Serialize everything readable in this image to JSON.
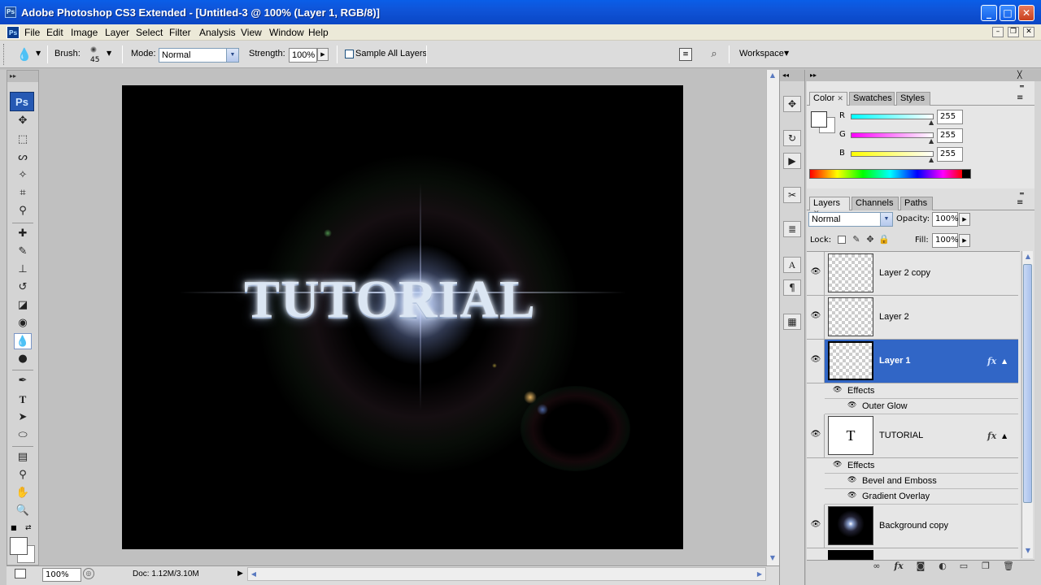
{
  "window": {
    "title": "Adobe Photoshop CS3 Extended - [Untitled-3 @ 100% (Layer 1, RGB/8)]",
    "app_icon": "Ps",
    "controls": [
      "minimize-icon",
      "maximize-icon",
      "close-icon"
    ]
  },
  "menu": [
    "File",
    "Edit",
    "Image",
    "Layer",
    "Select",
    "Filter",
    "Analysis",
    "View",
    "Window",
    "Help"
  ],
  "options_bar": {
    "brush_label": "Brush:",
    "brush_size": "45",
    "mode_label": "Mode:",
    "mode_value": "Normal",
    "strength_label": "Strength:",
    "strength_value": "100%",
    "sample_all_layers": "Sample All Layers",
    "sample_all_checked": false,
    "workspace_label": "Workspace"
  },
  "toolbox": {
    "logo": "Ps",
    "tools": [
      "move-tool",
      "marquee-tool",
      "lasso-tool",
      "magic-wand-tool",
      "crop-tool",
      "eyedropper-tool",
      "healing-brush-tool",
      "brush-tool",
      "clone-stamp-tool",
      "history-brush-tool",
      "eraser-tool",
      "paint-bucket-tool",
      "blur-tool",
      "dodge-tool",
      "pen-tool",
      "type-tool",
      "path-selection-tool",
      "shape-tool",
      "notes-tool",
      "eyedropper-alt-tool",
      "hand-tool",
      "zoom-tool"
    ],
    "active_tool": "blur-tool"
  },
  "canvas": {
    "text": "TUTORIAL",
    "background": "#000000"
  },
  "status": {
    "zoom": "100%",
    "doc_info": "Doc: 1.12M/3.10M"
  },
  "color_panel": {
    "tabs": [
      "Color",
      "Swatches",
      "Styles"
    ],
    "active_tab": "Color",
    "channels": [
      {
        "label": "R",
        "value": "255"
      },
      {
        "label": "G",
        "value": "255"
      },
      {
        "label": "B",
        "value": "255"
      }
    ],
    "foreground": "#ffffff",
    "background": "#ffffff"
  },
  "layers_panel": {
    "tabs": [
      "Layers",
      "Channels",
      "Paths"
    ],
    "active_tab": "Layers",
    "blend_mode": "Normal",
    "opacity_label": "Opacity:",
    "opacity_value": "100%",
    "lock_label": "Lock:",
    "fill_label": "Fill:",
    "fill_value": "100%",
    "layers": [
      {
        "name": "Layer 2 copy",
        "selected": false,
        "fx": false,
        "thumb": "transparent"
      },
      {
        "name": "Layer 2",
        "selected": false,
        "fx": false,
        "thumb": "transparent"
      },
      {
        "name": "Layer 1",
        "selected": true,
        "fx": true,
        "thumb": "transparent"
      },
      {
        "name": "TUTORIAL",
        "selected": false,
        "fx": true,
        "thumb": "type"
      },
      {
        "name": "Background copy",
        "selected": false,
        "fx": false,
        "thumb": "image"
      }
    ],
    "layer1_effects": {
      "label": "Effects",
      "items": [
        "Outer Glow"
      ]
    },
    "tutorial_effects": {
      "label": "Effects",
      "items": [
        "Bevel and Emboss",
        "Gradient Overlay"
      ]
    },
    "type_thumb_glyph": "T",
    "fx_glyph": "fx"
  }
}
